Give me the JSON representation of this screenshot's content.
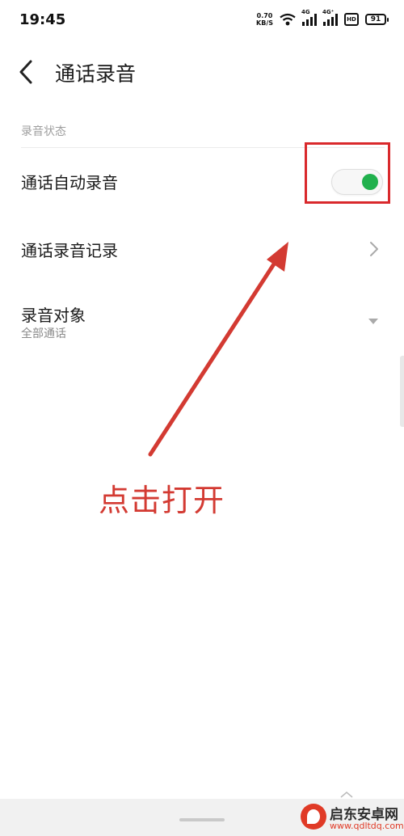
{
  "status_bar": {
    "time": "19:45",
    "net_speed_value": "0.70",
    "net_speed_unit": "KB/S",
    "signal_1_tag": "4G",
    "signal_2_tag": "4G⁺",
    "hd_label": "HD",
    "battery_level": "91",
    "icons": [
      "wifi-icon",
      "signal-icon",
      "signal-icon",
      "hd-icon",
      "battery-icon"
    ]
  },
  "header": {
    "back_icon": "back-icon",
    "title": "通话录音"
  },
  "section": {
    "header": "录音状态"
  },
  "settings": {
    "auto_record": {
      "label": "通话自动录音",
      "enabled": true
    },
    "record_list": {
      "label": "通话录音记录",
      "icon": "chevron-right-icon"
    },
    "record_target": {
      "label": "录音对象",
      "value": "全部通话",
      "icon": "dropdown-arrow-icon"
    }
  },
  "annotation": {
    "text": "点击打开",
    "color": "#d33a32"
  },
  "colors": {
    "toggle_on": "#21b14d",
    "highlight": "#d9292c"
  },
  "watermark": {
    "name": "启东安卓网",
    "url": "www.qdltdq.com"
  }
}
